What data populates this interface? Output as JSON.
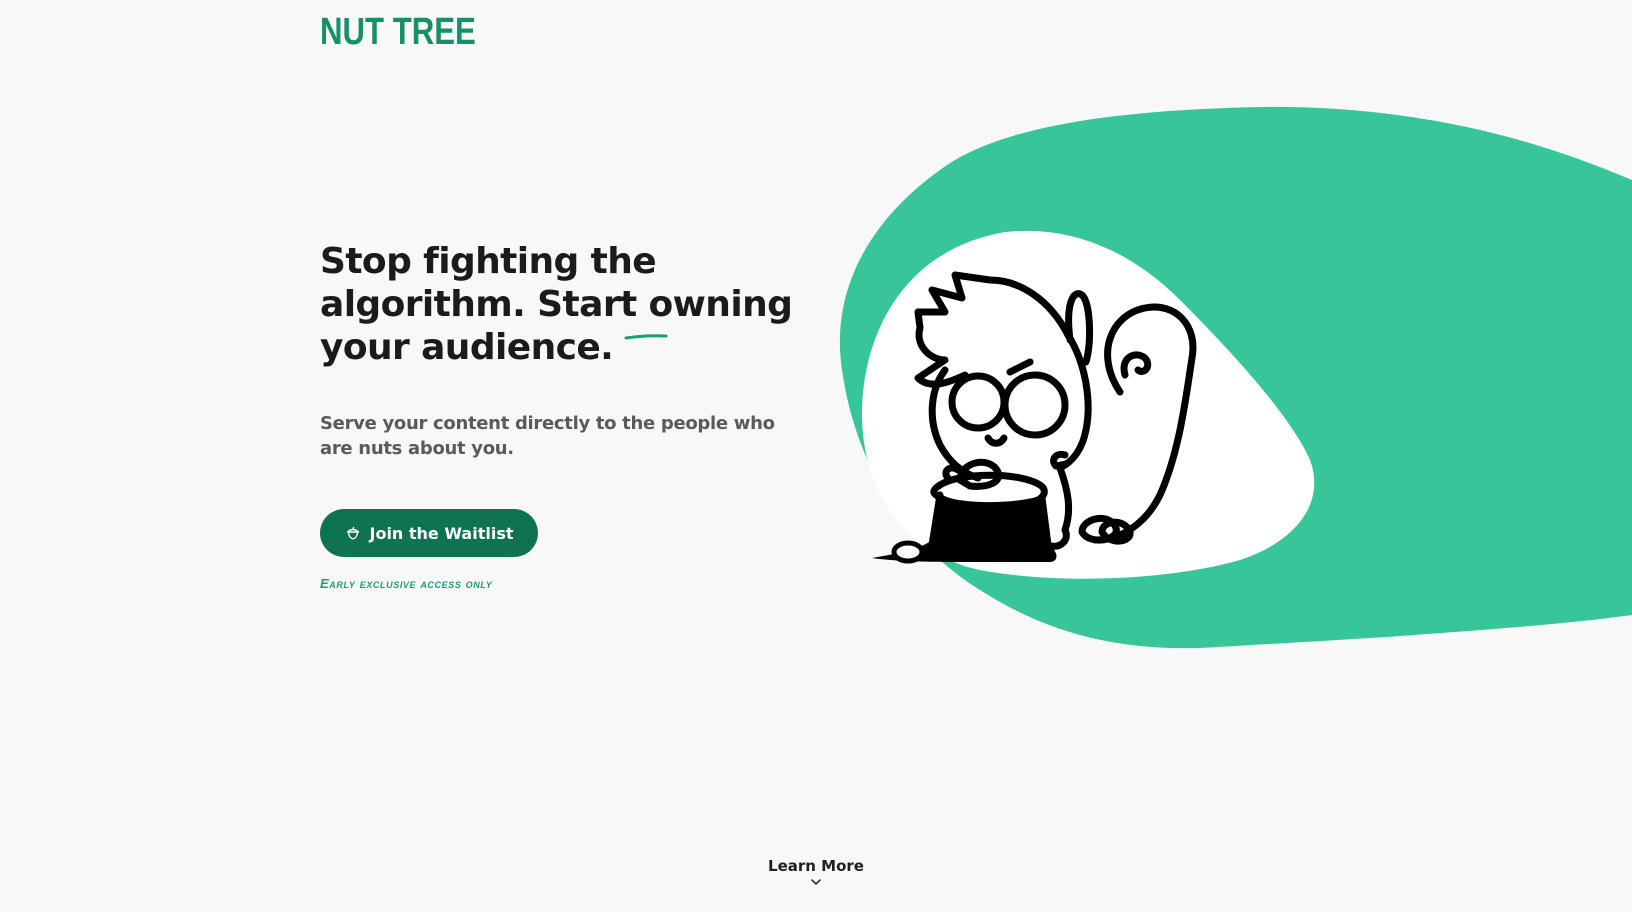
{
  "brand": {
    "name": "NUT TREE",
    "color": "#17906a"
  },
  "hero": {
    "title_lines": [
      "Stop fighting the",
      "algorithm. Start owning",
      "your audience."
    ],
    "subtitle": "Serve your content directly to the people who are nuts about you.",
    "cta_label": "Join the Waitlist",
    "cta_icon": "acorn-icon",
    "note": "Early exclusive access only",
    "illustration": "squirrel-on-stump-illustration"
  },
  "footer_nav": {
    "learn_more_label": "Learn More",
    "learn_more_icon": "chevron-down-icon"
  },
  "colors": {
    "accent": "#37c59a",
    "button": "#0f7352",
    "note": "#1a9e73",
    "background": "#f8f8f8"
  }
}
